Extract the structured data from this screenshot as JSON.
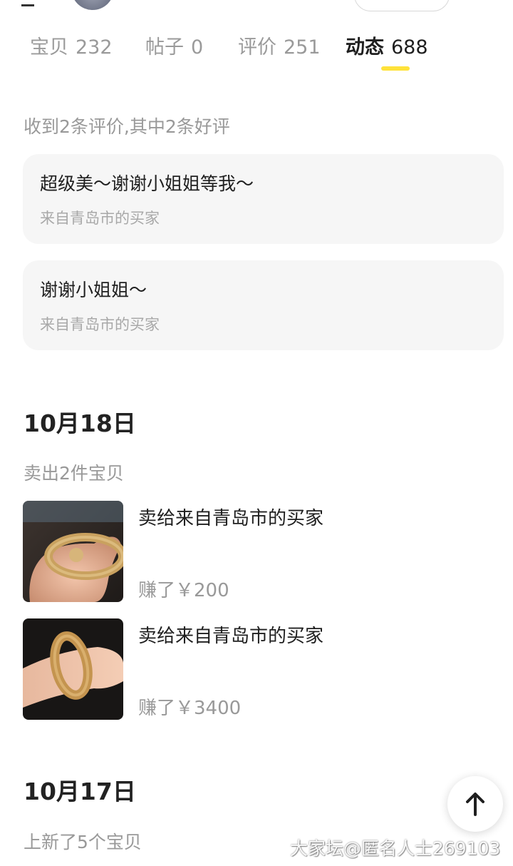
{
  "tabs": [
    {
      "label": "宝贝",
      "count": "232"
    },
    {
      "label": "帖子",
      "count": "0"
    },
    {
      "label": "评价",
      "count": "251"
    },
    {
      "label": "动态",
      "count": "688"
    }
  ],
  "reviews": {
    "summary": "收到2条评价,其中2条好评",
    "items": [
      {
        "text": "超级美～谢谢小姐姐等我～",
        "from": "来自青岛市的买家"
      },
      {
        "text": "谢谢小姐姐～",
        "from": "来自青岛市的买家"
      }
    ]
  },
  "day1": {
    "date": "10月18日",
    "summary": "卖出2件宝贝",
    "sales": [
      {
        "title": "卖给来自青岛市的买家",
        "earned": "赚了￥200"
      },
      {
        "title": "卖给来自青岛市的买家",
        "earned": "赚了￥3400"
      }
    ]
  },
  "day2": {
    "date": "10月17日",
    "summary": "上新了5个宝贝"
  },
  "icons": {
    "back_to_top": "arrow-up-icon"
  },
  "watermark": "大家坛@匿名人士269103",
  "colors": {
    "accent_underline": "#ffe23a",
    "card_bg": "#f6f6f6",
    "muted_text": "#999999"
  }
}
